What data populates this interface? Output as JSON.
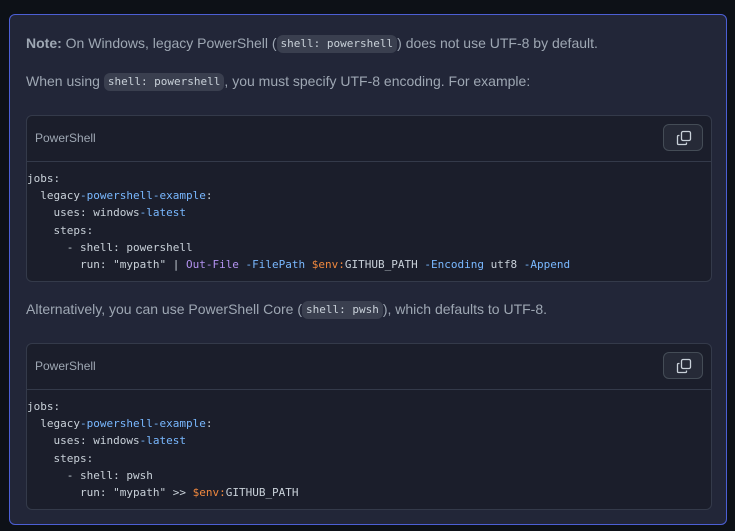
{
  "note": {
    "p1": {
      "label": "Note:",
      "before": " On Windows, legacy PowerShell (",
      "code": "shell: powershell",
      "after": ") does not use UTF-8 by default."
    },
    "p2": {
      "before": "When using ",
      "code": "shell: powershell",
      "after": ", you must specify UTF-8 encoding. For example:"
    },
    "p3": {
      "before": "Alternatively, you can use PowerShell Core (",
      "code": "shell: pwsh",
      "after": "), which defaults to UTF-8."
    }
  },
  "code_blocks": [
    {
      "language": "PowerShell",
      "copy_icon": "copy-icon",
      "lines": {
        "l1": "jobs:",
        "l2a": "  legacy",
        "l2b": "-powershell-example",
        "l2c": ":",
        "l3a": "    uses: windows",
        "l3b": "-latest",
        "l4": "    steps:",
        "l5": "      - shell: powershell",
        "l6a": "        run: ",
        "l6b": "\"mypath\"",
        "l6c": " | ",
        "l6d": "Out-File",
        "l6e": " -FilePath",
        "l6f": " $env:",
        "l6g": "GITHUB_PATH",
        "l6h": " -Encoding",
        "l6i": " utf8",
        "l6j": " -Append"
      }
    },
    {
      "language": "PowerShell",
      "copy_icon": "copy-icon",
      "lines": {
        "l1": "jobs:",
        "l2a": "  legacy",
        "l2b": "-powershell-example",
        "l2c": ":",
        "l3a": "    uses: windows",
        "l3b": "-latest",
        "l4": "    steps:",
        "l5": "      - shell: pwsh",
        "l6a": "        run: ",
        "l6b": "\"mypath\"",
        "l6c": " >> ",
        "l6d": "$env:",
        "l6e": "GITHUB_PATH"
      }
    }
  ]
}
